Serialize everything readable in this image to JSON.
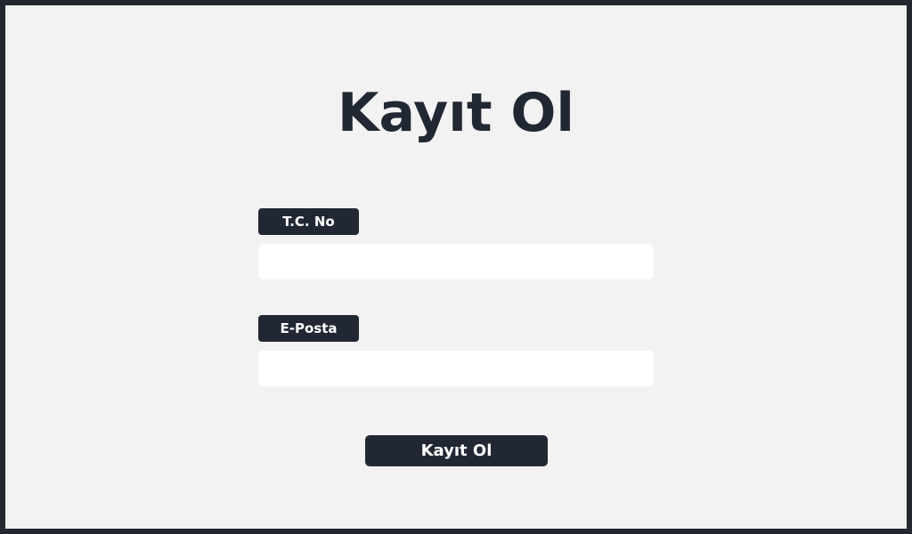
{
  "page": {
    "title": "Kayıt Ol"
  },
  "form": {
    "tc_label": "T.C. No",
    "tc_value": "",
    "email_label": "E-Posta",
    "email_value": "",
    "submit_label": "Kayıt Ol"
  },
  "colors": {
    "background": "#f2f2f2",
    "frame": "#232830",
    "accent": "#222833",
    "input_bg": "#ffffff"
  }
}
